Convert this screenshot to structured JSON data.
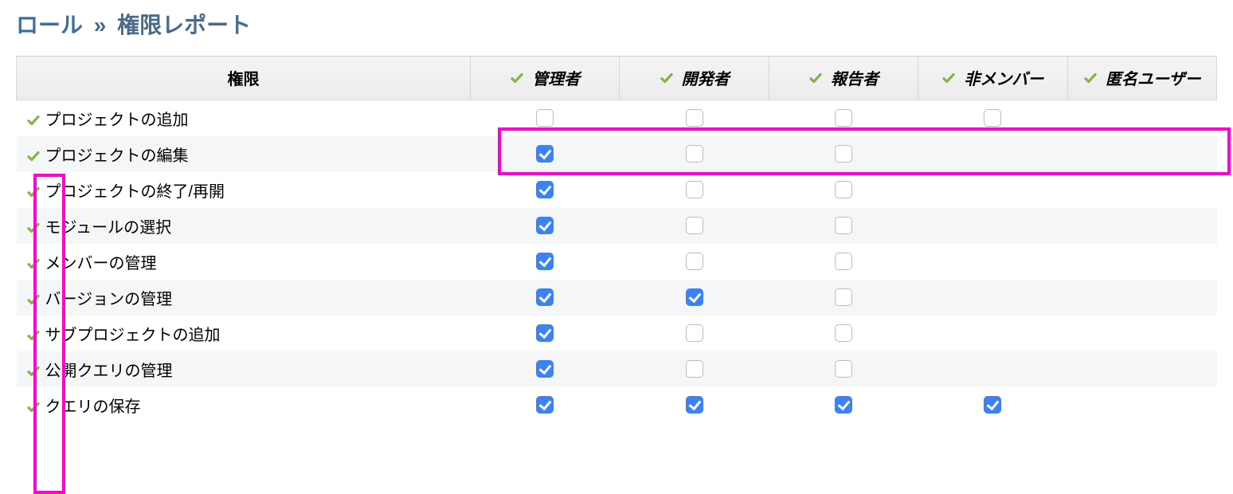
{
  "title": {
    "roles_link": "ロール",
    "separator": "»",
    "page": "権限レポート"
  },
  "headers": {
    "permission": "権限",
    "roles": [
      "管理者",
      "開発者",
      "報告者",
      "非メンバー",
      "匿名ユーザー"
    ]
  },
  "rows": [
    {
      "label": "プロジェクトの追加",
      "cells": [
        false,
        false,
        false,
        false,
        null
      ]
    },
    {
      "label": "プロジェクトの編集",
      "cells": [
        true,
        false,
        false,
        null,
        null
      ]
    },
    {
      "label": "プロジェクトの終了/再開",
      "cells": [
        true,
        false,
        false,
        null,
        null
      ]
    },
    {
      "label": "モジュールの選択",
      "cells": [
        true,
        false,
        false,
        null,
        null
      ]
    },
    {
      "label": "メンバーの管理",
      "cells": [
        true,
        false,
        false,
        null,
        null
      ]
    },
    {
      "label": "バージョンの管理",
      "cells": [
        true,
        true,
        false,
        null,
        null
      ]
    },
    {
      "label": "サブプロジェクトの追加",
      "cells": [
        true,
        false,
        false,
        null,
        null
      ]
    },
    {
      "label": "公開クエリの管理",
      "cells": [
        true,
        false,
        false,
        null,
        null
      ]
    },
    {
      "label": "クエリの保存",
      "cells": [
        true,
        true,
        true,
        true,
        null
      ]
    }
  ]
}
